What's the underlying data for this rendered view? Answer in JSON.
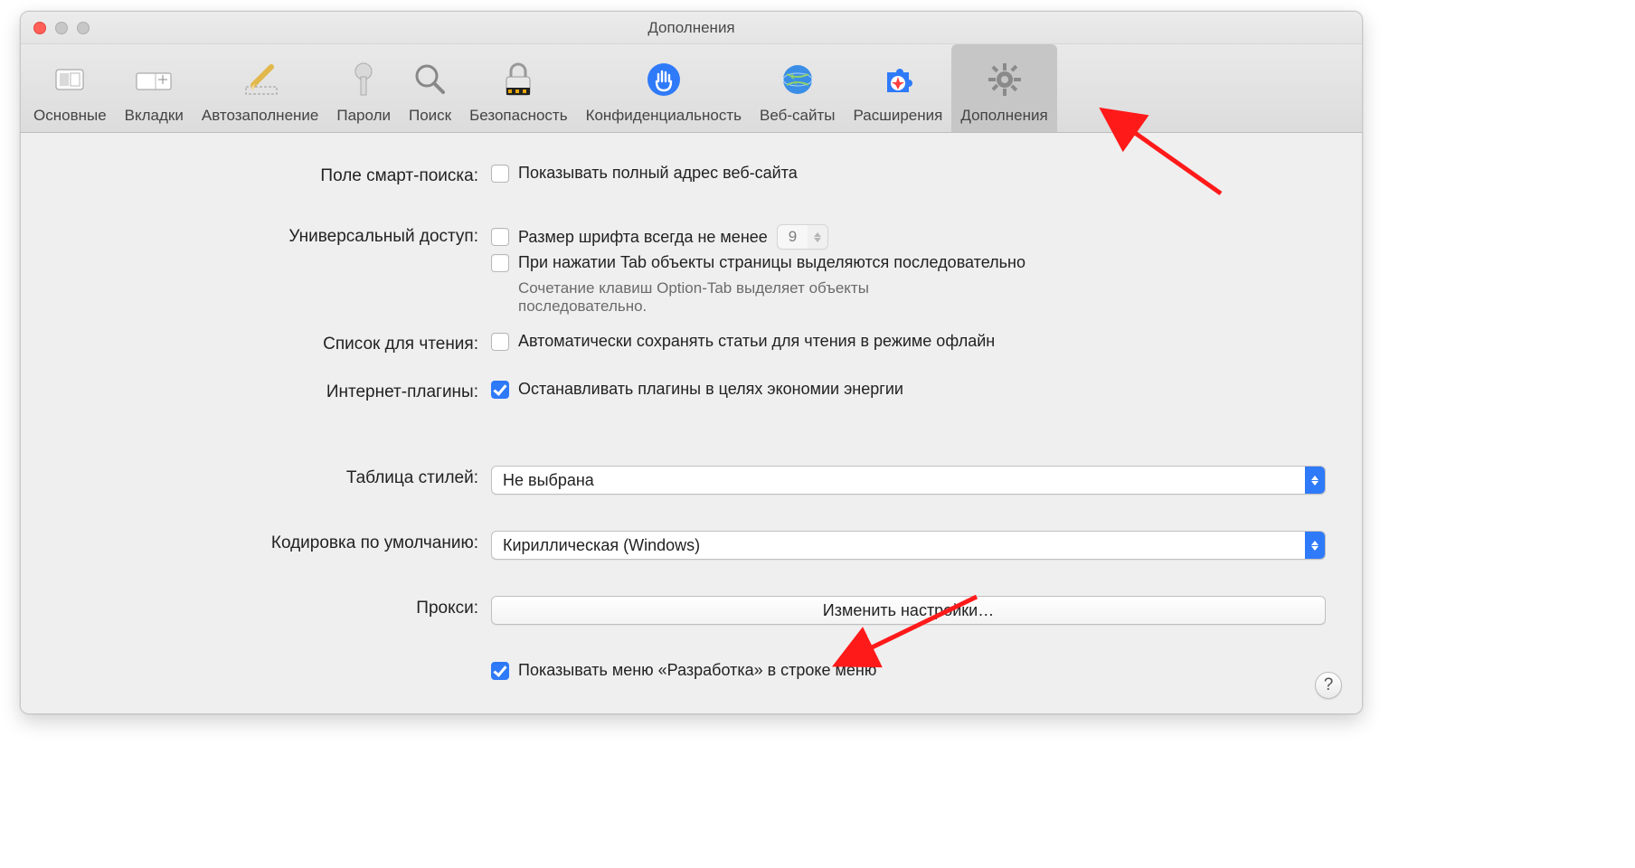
{
  "window": {
    "title": "Дополнения"
  },
  "toolbar": {
    "items": [
      {
        "label": "Основные"
      },
      {
        "label": "Вкладки"
      },
      {
        "label": "Автозаполнение"
      },
      {
        "label": "Пароли"
      },
      {
        "label": "Поиск"
      },
      {
        "label": "Безопасность"
      },
      {
        "label": "Конфиденциальность"
      },
      {
        "label": "Веб-сайты"
      },
      {
        "label": "Расширения"
      },
      {
        "label": "Дополнения"
      }
    ]
  },
  "settings": {
    "smart_search": {
      "label": "Поле смарт-поиска:",
      "checkbox": "Показывать полный адрес веб-сайта"
    },
    "accessibility": {
      "label": "Универсальный доступ:",
      "font_checkbox": "Размер шрифта всегда не менее",
      "font_value": "9",
      "tab_checkbox": "При нажатии Tab объекты страницы выделяются последовательно",
      "hint": "Сочетание клавиш Option-Tab выделяет объекты последовательно."
    },
    "reading_list": {
      "label": "Список для чтения:",
      "checkbox": "Автоматически сохранять статьи для чтения в режиме офлайн"
    },
    "plugins": {
      "label": "Интернет-плагины:",
      "checkbox": "Останавливать плагины в целях экономии энергии"
    },
    "stylesheet": {
      "label": "Таблица стилей:",
      "value": "Не выбрана"
    },
    "encoding": {
      "label": "Кодировка по умолчанию:",
      "value": "Кириллическая (Windows)"
    },
    "proxy": {
      "label": "Прокси:",
      "button": "Изменить настройки…"
    },
    "develop_menu": {
      "checkbox": "Показывать меню «Разработка» в строке меню"
    }
  },
  "help": "?"
}
